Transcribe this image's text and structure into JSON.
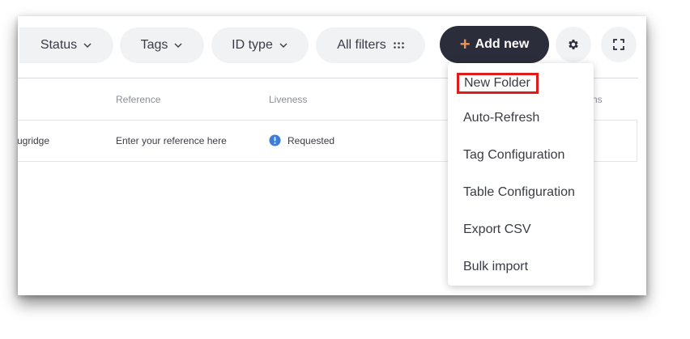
{
  "toolbar": {
    "filters": [
      {
        "label": "Status"
      },
      {
        "label": "Tags"
      },
      {
        "label": "ID type"
      }
    ],
    "all_filters_label": "All filters",
    "add_new_label": "Add new"
  },
  "table": {
    "headers": [
      "Reference",
      "Liveness",
      "ns"
    ],
    "row": {
      "name_fragment": "ugridge",
      "reference_placeholder": "Enter your reference here",
      "liveness": "Requested"
    }
  },
  "menu": {
    "items": [
      "New Folder",
      "Auto-Refresh",
      "Tag Configuration",
      "Table Configuration",
      "Export CSV",
      "Bulk import"
    ],
    "highlighted_index": 0
  },
  "colors": {
    "add_new_bg": "#2b2d3b",
    "plus_accent": "#f2914b",
    "info_blue": "#3b7dd8",
    "highlight_border": "#e01b1b"
  }
}
